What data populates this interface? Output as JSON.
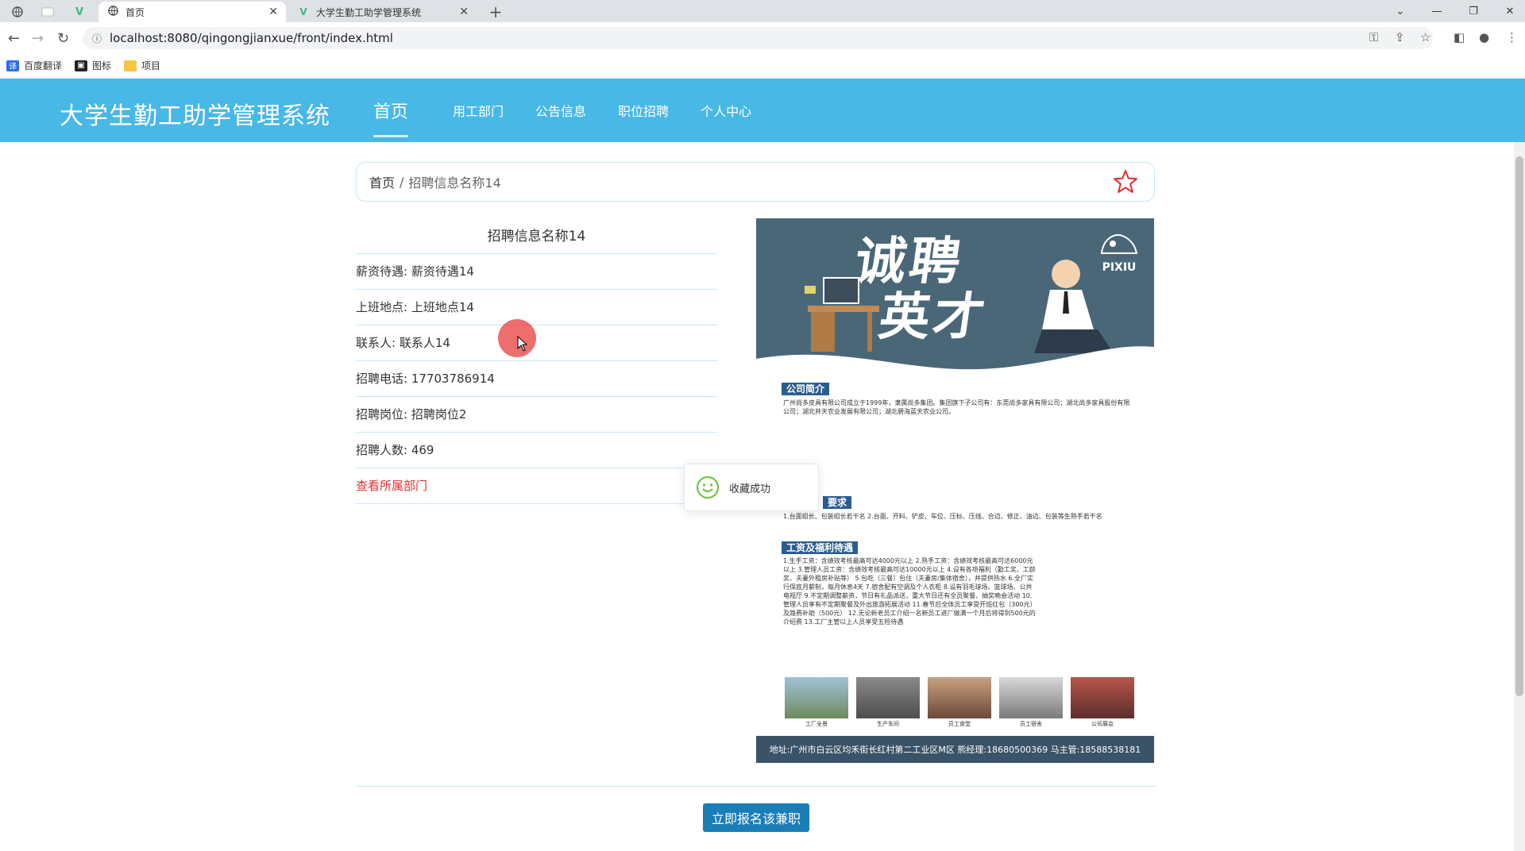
{
  "browser": {
    "tabs": [
      {
        "title": "首页",
        "icon": "globe-icon"
      },
      {
        "title": "大学生勤工助学管理系统",
        "icon": "vue-logo-icon"
      }
    ],
    "url": "localhost:8080/qingongjianxue/front/index.html",
    "bookmarks": [
      {
        "label": "百度翻译",
        "icon": "translate-icon"
      },
      {
        "label": "图标",
        "icon": "image-icon"
      },
      {
        "label": "项目",
        "icon": "folder-icon"
      }
    ]
  },
  "site": {
    "title": "大学生勤工助学管理系统",
    "menu": [
      "首页",
      "用工部门",
      "公告信息",
      "职位招聘",
      "个人中心"
    ],
    "active_menu": "首页"
  },
  "breadcrumb": {
    "home": "首页",
    "separator": "/",
    "current": "招聘信息名称14"
  },
  "detail": {
    "title": "招聘信息名称14",
    "rows": [
      "薪资待遇: 薪资待遇14",
      "上班地点: 上班地点14",
      "联系人: 联系人14",
      "招聘电话: 17703786914",
      "招聘岗位: 招聘岗位2",
      "招聘人数: 469"
    ],
    "link": "查看所属部门"
  },
  "poster": {
    "headline_1": "诚聘",
    "headline_2": "英才",
    "logo_text": "PIXIU",
    "sections": [
      "公司简介",
      "要求",
      "工资及福利待遇"
    ],
    "intro_text": "广州尚多皮具有限公司成立于1999年，隶属尚多集团。集团旗下子公司有：东莞尚多家具有限公司；湖北尚多家具股份有限公司；湖北井天农业发展有限公司；湖北碧海蓝天农业公司。",
    "requirements": "1.台面组长、包装组长若干名  2.台面、开料、铲皮、车位、压标、压线、合边、修正、油边、包装等生熟手若干名",
    "benefits": "1.生手工资：含绩效考核最高可达4000元以上 2.熟手工资：含绩效考核最高可达6000元以上 3.管理人员工资：含绩效考核最高可达10000元以上 4.设有各项福利（勤工奖、工龄奖、夫妻外租房补贴等） 5.包吃（三餐）包住（夫妻房/集体宿舍），并提供热水 6.全厂实行保底月薪制，每月休息4天 7.宿舍配有空调及个人衣柜 8.设有羽毛球场、篮球场、公共电视厅 9.不定期调整薪资，节日有礼品派送，重大节日还有全员聚餐、抽奖晚会活动 10.管理人员享有不定期聚餐及外出旅游拓展活动 11.春节后全体员工享受开班红包（300元）及路费补助（500元） 12.无论新老员工介绍一名新员工进厂做满一个月后将得到500元的介绍费 13.工厂主管以上人员享受五险待遇",
    "photo_captions": [
      "工厂全景",
      "生产车间",
      "员工食堂",
      "员工宿舍",
      "公司展会"
    ],
    "footer": "地址:广州市白云区均禾街长红村第二工业区M区    熊经理:18680500369   马主管:18588538181"
  },
  "toast": {
    "message": "收藏成功"
  },
  "apply_button": "立即报名该兼职",
  "colors": {
    "header_bg": "#48b8e6",
    "button_bg": "#1a7db6",
    "link_red": "#e22d2d",
    "border": "#c7e6f2"
  }
}
